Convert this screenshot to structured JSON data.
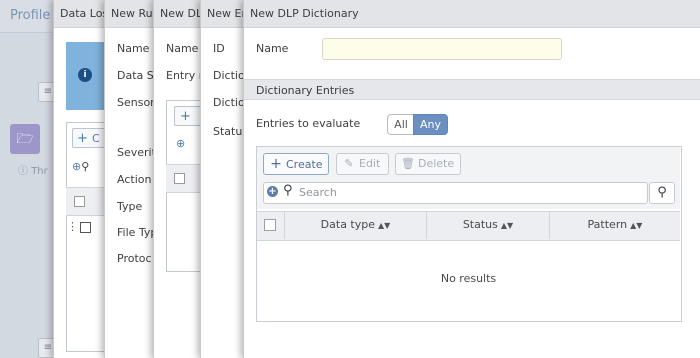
{
  "background": {
    "title": "Profile",
    "info_text": "Thr"
  },
  "panels": {
    "data_loss": {
      "title": "Data Los",
      "create_label": "C"
    },
    "new_rule": {
      "title": "New Ru",
      "labels": [
        "Name",
        "Data So",
        "Sensor",
        "Severit",
        "Action",
        "Type",
        "File Typ",
        "Protoc"
      ]
    },
    "new_dl": {
      "title": "New DL",
      "labels": [
        "Name",
        "Entry r"
      ]
    },
    "new_en": {
      "title": "New En",
      "labels": [
        "ID",
        "Diction",
        "Dictio",
        "Status"
      ]
    }
  },
  "dictionary": {
    "title": "New DLP Dictionary",
    "name_label": "Name",
    "name_value": "",
    "section_title": "Dictionary Entries",
    "evaluate_label": "Entries to evaluate",
    "evaluate_options": [
      "All",
      "Any"
    ],
    "evaluate_selected": "Any",
    "toolbar": {
      "create": "Create",
      "edit": "Edit",
      "delete": "Delete"
    },
    "search_placeholder": "Search",
    "columns": [
      "Data type",
      "Status",
      "Pattern"
    ],
    "empty_text": "No results"
  },
  "colors": {
    "accent": "#6b8fc0",
    "name_input_bg": "#fdfde9",
    "info_box": "#7fb2dc"
  }
}
